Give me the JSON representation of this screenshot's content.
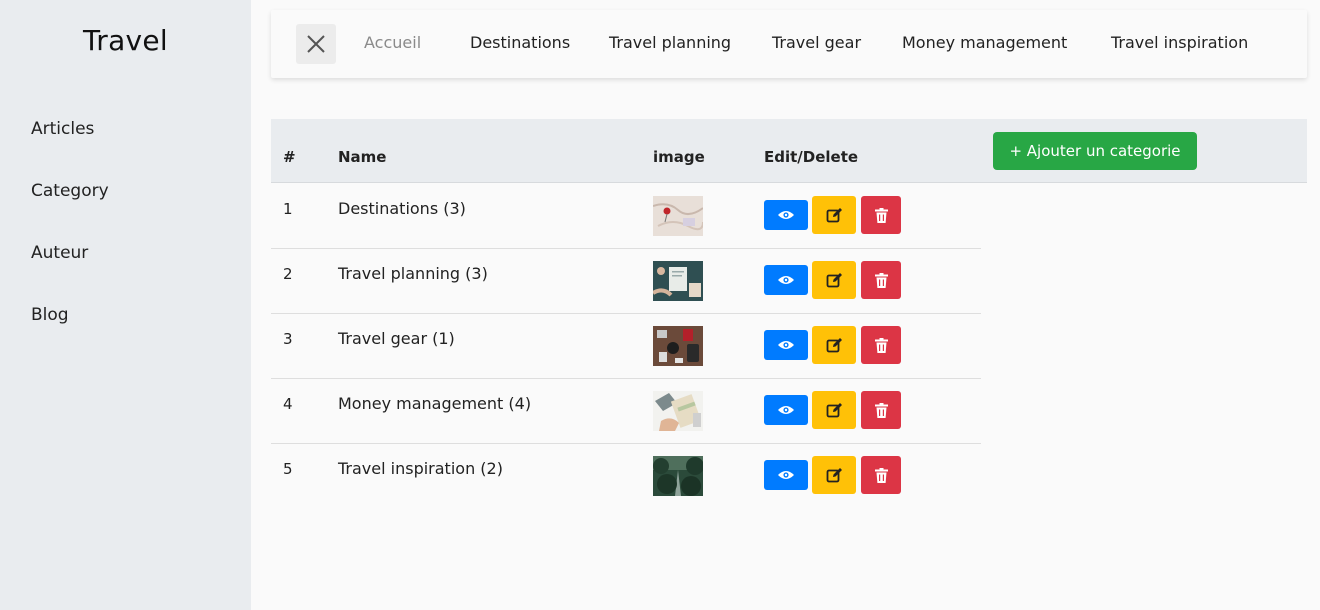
{
  "sidebar": {
    "brand": "Travel",
    "items": [
      {
        "label": "Articles"
      },
      {
        "label": "Category"
      },
      {
        "label": "Auteur"
      },
      {
        "label": "Blog"
      }
    ]
  },
  "topnav": {
    "close_icon": "close-icon",
    "links": [
      {
        "label": "Accueil",
        "muted": true
      },
      {
        "label": "Destinations"
      },
      {
        "label": "Travel planning"
      },
      {
        "label": "Travel gear"
      },
      {
        "label": "Money management"
      },
      {
        "label": "Travel inspiration"
      }
    ]
  },
  "table": {
    "headers": {
      "num": "#",
      "name": "Name",
      "image": "image",
      "actions": "Edit/Delete"
    },
    "add_button": "+ Ajouter un categorie",
    "rows": [
      {
        "num": "1",
        "name": "Destinations (3)",
        "image": "map-with-pin-thumbnail"
      },
      {
        "num": "2",
        "name": "Travel planning (3)",
        "image": "planning-desk-thumbnail"
      },
      {
        "num": "3",
        "name": "Travel gear (1)",
        "image": "travel-gear-flatlay-thumbnail"
      },
      {
        "num": "4",
        "name": "Money management (4)",
        "image": "money-calculator-thumbnail"
      },
      {
        "num": "5",
        "name": "Travel inspiration (2)",
        "image": "forest-road-thumbnail"
      }
    ],
    "action_icons": {
      "view": "eye-icon",
      "edit": "edit-icon",
      "delete": "trash-icon"
    }
  },
  "colors": {
    "view": "#007bff",
    "edit": "#ffc107",
    "delete": "#dc3545",
    "add": "#28a745",
    "sidebar_bg": "#e9ecef"
  }
}
